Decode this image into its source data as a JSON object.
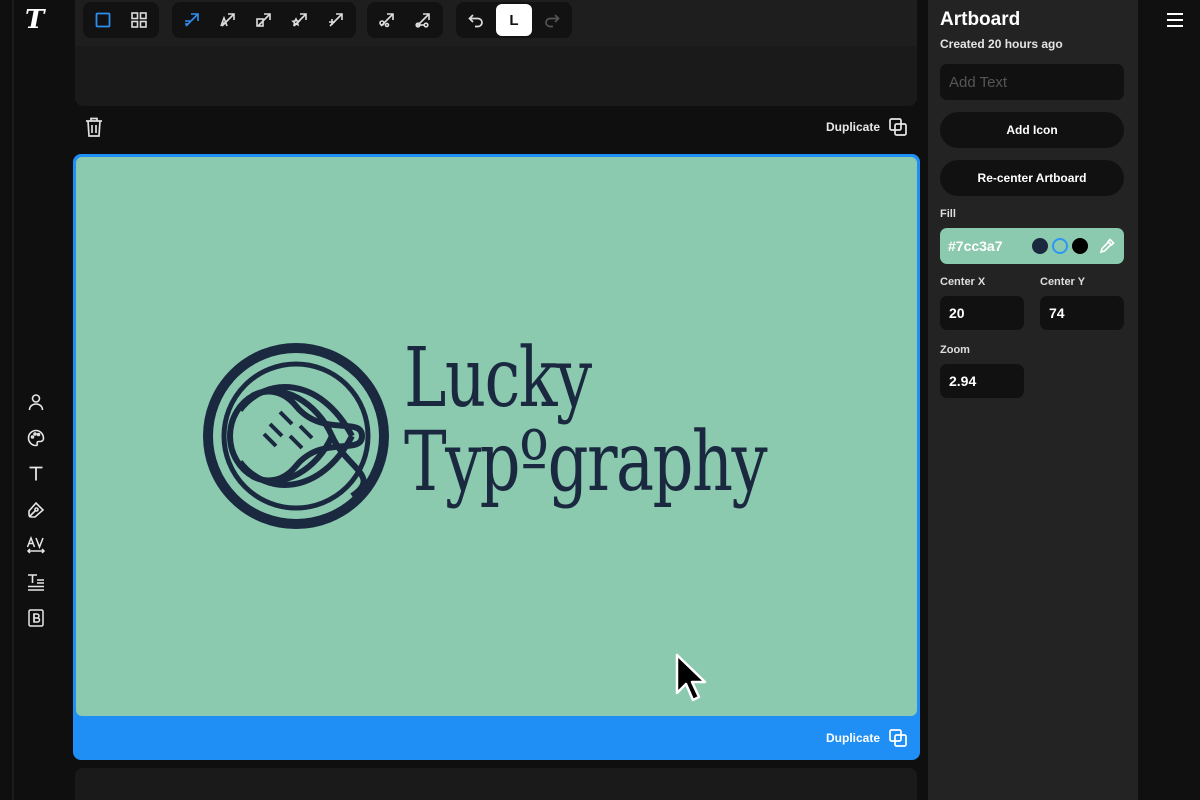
{
  "app": {
    "logo_letter": "T"
  },
  "toolbar": {
    "undo_icon": "undo-icon",
    "redo_icon": "redo-icon",
    "active_tool_label": "L"
  },
  "artboard_header": {
    "duplicate_label": "Duplicate"
  },
  "artboard": {
    "fill": "#7cc3a7",
    "title_line1": "Lucky",
    "title_line2": "Typºgraphy",
    "duplicate_label": "Duplicate"
  },
  "panel": {
    "title": "Artboard",
    "subtitle": "Created 20 hours ago",
    "add_text_placeholder": "Add Text",
    "add_icon_label": "Add Icon",
    "recenter_label": "Re-center Artboard",
    "fill_label": "Fill",
    "fill_value": "#7cc3a7",
    "fill_swatches": [
      "#1b2940",
      "#7cc3a7",
      "#000000"
    ],
    "center_x_label": "Center X",
    "center_x_value": "20",
    "center_y_label": "Center Y",
    "center_y_value": "74",
    "zoom_label": "Zoom",
    "zoom_value": "2.94"
  },
  "colors": {
    "accent": "#1f8ff5",
    "ink": "#1b2940",
    "artboard_bg": "#8ccab0"
  }
}
